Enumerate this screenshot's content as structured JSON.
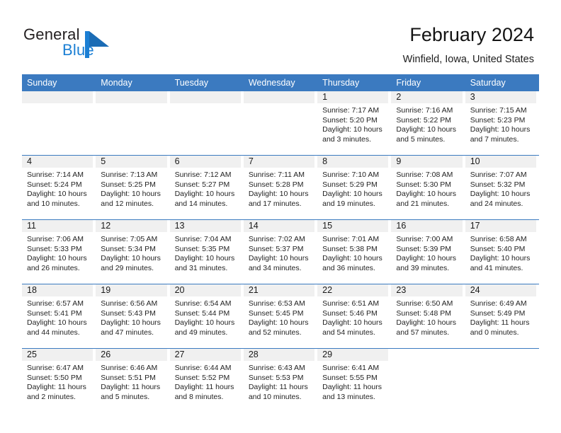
{
  "brand": {
    "name_part1": "General",
    "name_part2": "Blue",
    "accent_color": "#1b7fd4",
    "logo_icon": "triangle-flag-icon"
  },
  "header": {
    "title": "February 2024",
    "location": "Winfield, Iowa, United States"
  },
  "calendar": {
    "header_bg": "#3b7ac0",
    "daynum_band_bg": "#f0f0f0",
    "weekday_headers": [
      "Sunday",
      "Monday",
      "Tuesday",
      "Wednesday",
      "Thursday",
      "Friday",
      "Saturday"
    ],
    "weeks": [
      [
        {
          "day": "",
          "sunrise": "",
          "sunset": "",
          "daylight_line1": "",
          "daylight_line2": ""
        },
        {
          "day": "",
          "sunrise": "",
          "sunset": "",
          "daylight_line1": "",
          "daylight_line2": ""
        },
        {
          "day": "",
          "sunrise": "",
          "sunset": "",
          "daylight_line1": "",
          "daylight_line2": ""
        },
        {
          "day": "",
          "sunrise": "",
          "sunset": "",
          "daylight_line1": "",
          "daylight_line2": ""
        },
        {
          "day": "1",
          "sunrise": "Sunrise: 7:17 AM",
          "sunset": "Sunset: 5:20 PM",
          "daylight_line1": "Daylight: 10 hours",
          "daylight_line2": "and 3 minutes."
        },
        {
          "day": "2",
          "sunrise": "Sunrise: 7:16 AM",
          "sunset": "Sunset: 5:22 PM",
          "daylight_line1": "Daylight: 10 hours",
          "daylight_line2": "and 5 minutes."
        },
        {
          "day": "3",
          "sunrise": "Sunrise: 7:15 AM",
          "sunset": "Sunset: 5:23 PM",
          "daylight_line1": "Daylight: 10 hours",
          "daylight_line2": "and 7 minutes."
        }
      ],
      [
        {
          "day": "4",
          "sunrise": "Sunrise: 7:14 AM",
          "sunset": "Sunset: 5:24 PM",
          "daylight_line1": "Daylight: 10 hours",
          "daylight_line2": "and 10 minutes."
        },
        {
          "day": "5",
          "sunrise": "Sunrise: 7:13 AM",
          "sunset": "Sunset: 5:25 PM",
          "daylight_line1": "Daylight: 10 hours",
          "daylight_line2": "and 12 minutes."
        },
        {
          "day": "6",
          "sunrise": "Sunrise: 7:12 AM",
          "sunset": "Sunset: 5:27 PM",
          "daylight_line1": "Daylight: 10 hours",
          "daylight_line2": "and 14 minutes."
        },
        {
          "day": "7",
          "sunrise": "Sunrise: 7:11 AM",
          "sunset": "Sunset: 5:28 PM",
          "daylight_line1": "Daylight: 10 hours",
          "daylight_line2": "and 17 minutes."
        },
        {
          "day": "8",
          "sunrise": "Sunrise: 7:10 AM",
          "sunset": "Sunset: 5:29 PM",
          "daylight_line1": "Daylight: 10 hours",
          "daylight_line2": "and 19 minutes."
        },
        {
          "day": "9",
          "sunrise": "Sunrise: 7:08 AM",
          "sunset": "Sunset: 5:30 PM",
          "daylight_line1": "Daylight: 10 hours",
          "daylight_line2": "and 21 minutes."
        },
        {
          "day": "10",
          "sunrise": "Sunrise: 7:07 AM",
          "sunset": "Sunset: 5:32 PM",
          "daylight_line1": "Daylight: 10 hours",
          "daylight_line2": "and 24 minutes."
        }
      ],
      [
        {
          "day": "11",
          "sunrise": "Sunrise: 7:06 AM",
          "sunset": "Sunset: 5:33 PM",
          "daylight_line1": "Daylight: 10 hours",
          "daylight_line2": "and 26 minutes."
        },
        {
          "day": "12",
          "sunrise": "Sunrise: 7:05 AM",
          "sunset": "Sunset: 5:34 PM",
          "daylight_line1": "Daylight: 10 hours",
          "daylight_line2": "and 29 minutes."
        },
        {
          "day": "13",
          "sunrise": "Sunrise: 7:04 AM",
          "sunset": "Sunset: 5:35 PM",
          "daylight_line1": "Daylight: 10 hours",
          "daylight_line2": "and 31 minutes."
        },
        {
          "day": "14",
          "sunrise": "Sunrise: 7:02 AM",
          "sunset": "Sunset: 5:37 PM",
          "daylight_line1": "Daylight: 10 hours",
          "daylight_line2": "and 34 minutes."
        },
        {
          "day": "15",
          "sunrise": "Sunrise: 7:01 AM",
          "sunset": "Sunset: 5:38 PM",
          "daylight_line1": "Daylight: 10 hours",
          "daylight_line2": "and 36 minutes."
        },
        {
          "day": "16",
          "sunrise": "Sunrise: 7:00 AM",
          "sunset": "Sunset: 5:39 PM",
          "daylight_line1": "Daylight: 10 hours",
          "daylight_line2": "and 39 minutes."
        },
        {
          "day": "17",
          "sunrise": "Sunrise: 6:58 AM",
          "sunset": "Sunset: 5:40 PM",
          "daylight_line1": "Daylight: 10 hours",
          "daylight_line2": "and 41 minutes."
        }
      ],
      [
        {
          "day": "18",
          "sunrise": "Sunrise: 6:57 AM",
          "sunset": "Sunset: 5:41 PM",
          "daylight_line1": "Daylight: 10 hours",
          "daylight_line2": "and 44 minutes."
        },
        {
          "day": "19",
          "sunrise": "Sunrise: 6:56 AM",
          "sunset": "Sunset: 5:43 PM",
          "daylight_line1": "Daylight: 10 hours",
          "daylight_line2": "and 47 minutes."
        },
        {
          "day": "20",
          "sunrise": "Sunrise: 6:54 AM",
          "sunset": "Sunset: 5:44 PM",
          "daylight_line1": "Daylight: 10 hours",
          "daylight_line2": "and 49 minutes."
        },
        {
          "day": "21",
          "sunrise": "Sunrise: 6:53 AM",
          "sunset": "Sunset: 5:45 PM",
          "daylight_line1": "Daylight: 10 hours",
          "daylight_line2": "and 52 minutes."
        },
        {
          "day": "22",
          "sunrise": "Sunrise: 6:51 AM",
          "sunset": "Sunset: 5:46 PM",
          "daylight_line1": "Daylight: 10 hours",
          "daylight_line2": "and 54 minutes."
        },
        {
          "day": "23",
          "sunrise": "Sunrise: 6:50 AM",
          "sunset": "Sunset: 5:48 PM",
          "daylight_line1": "Daylight: 10 hours",
          "daylight_line2": "and 57 minutes."
        },
        {
          "day": "24",
          "sunrise": "Sunrise: 6:49 AM",
          "sunset": "Sunset: 5:49 PM",
          "daylight_line1": "Daylight: 11 hours",
          "daylight_line2": "and 0 minutes."
        }
      ],
      [
        {
          "day": "25",
          "sunrise": "Sunrise: 6:47 AM",
          "sunset": "Sunset: 5:50 PM",
          "daylight_line1": "Daylight: 11 hours",
          "daylight_line2": "and 2 minutes."
        },
        {
          "day": "26",
          "sunrise": "Sunrise: 6:46 AM",
          "sunset": "Sunset: 5:51 PM",
          "daylight_line1": "Daylight: 11 hours",
          "daylight_line2": "and 5 minutes."
        },
        {
          "day": "27",
          "sunrise": "Sunrise: 6:44 AM",
          "sunset": "Sunset: 5:52 PM",
          "daylight_line1": "Daylight: 11 hours",
          "daylight_line2": "and 8 minutes."
        },
        {
          "day": "28",
          "sunrise": "Sunrise: 6:43 AM",
          "sunset": "Sunset: 5:53 PM",
          "daylight_line1": "Daylight: 11 hours",
          "daylight_line2": "and 10 minutes."
        },
        {
          "day": "29",
          "sunrise": "Sunrise: 6:41 AM",
          "sunset": "Sunset: 5:55 PM",
          "daylight_line1": "Daylight: 11 hours",
          "daylight_line2": "and 13 minutes."
        },
        {
          "day": "",
          "sunrise": "",
          "sunset": "",
          "daylight_line1": "",
          "daylight_line2": ""
        },
        {
          "day": "",
          "sunrise": "",
          "sunset": "",
          "daylight_line1": "",
          "daylight_line2": ""
        }
      ]
    ]
  }
}
